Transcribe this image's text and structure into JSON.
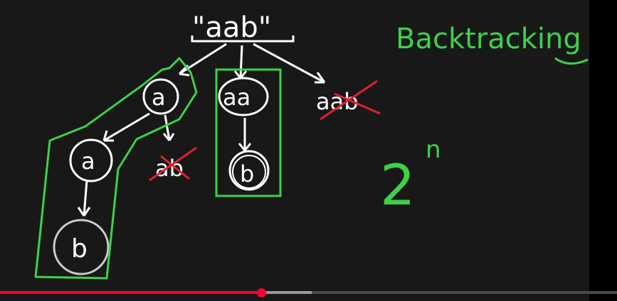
{
  "video": {
    "progress_fraction": 0.423,
    "buffer_fraction": 0.505,
    "played_color": "#ff0033"
  },
  "whiteboard": {
    "root_label": "\"aab\"",
    "title_label": "Backtracking",
    "complexity_base": "2",
    "complexity_exponent": "n",
    "nodes": {
      "level1_a": "a",
      "level1_aa": "aa",
      "level1_aab": "aab",
      "level2_a": "a",
      "level2_ab": "ab",
      "level2_b_mid": "b",
      "level3_b": "b"
    },
    "ink_color": "#ffffff",
    "highlight_color": "#3dd14a",
    "strike_color": "#e02030"
  }
}
